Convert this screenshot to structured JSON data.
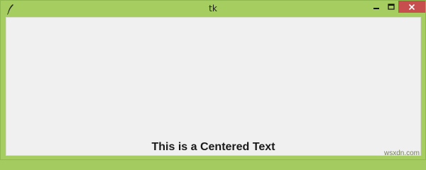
{
  "window": {
    "title": "tk",
    "icon": "feather-icon",
    "controls": {
      "minimize": "minimize-icon",
      "maximize": "maximize-icon",
      "close": "close-icon"
    },
    "colors": {
      "frame": "#a5cd60",
      "client": "#f0f0f0",
      "close_button": "#c7504f"
    }
  },
  "content": {
    "label_text": "This is a Centered Text"
  },
  "watermark": "wsxdn.com"
}
